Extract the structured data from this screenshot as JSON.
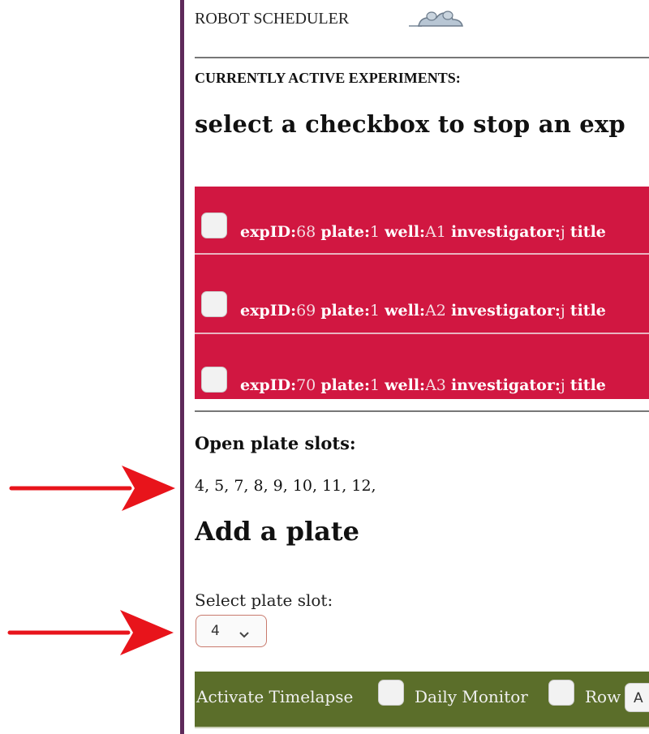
{
  "header": {
    "title": "ROBOT SCHEDULER",
    "logo_icon": "robot-icon"
  },
  "active": {
    "section_title": "CURRENTLY ACTIVE EXPERIMENTS:",
    "instruction": "select a checkbox to stop an exp",
    "field_labels": {
      "exp_id": "expID:",
      "plate": "plate:",
      "well": "well:",
      "investigator": "investigator:",
      "title_partial": "title"
    },
    "rows": [
      {
        "exp_id": "68",
        "plate": "1",
        "well": "A1",
        "investigator": "j",
        "checked": false
      },
      {
        "exp_id": "69",
        "plate": "1",
        "well": "A2",
        "investigator": "j",
        "checked": false
      },
      {
        "exp_id": "70",
        "plate": "1",
        "well": "A3",
        "investigator": "j",
        "checked": false
      }
    ]
  },
  "open_slots": {
    "label": "Open plate slots:",
    "list": "4, 5, 7, 8, 9, 10, 11, 12,"
  },
  "add_plate": {
    "heading": "Add a plate",
    "select_label": "Select plate slot:",
    "selected_slot": "4"
  },
  "options": {
    "activate_timelapse_label": "Activate Timelapse",
    "activate_timelapse_checked": false,
    "daily_monitor_label": "Daily Monitor",
    "daily_monitor_checked": false,
    "row_label": "Row",
    "row_value": "A"
  },
  "colors": {
    "active_table_bg": "#d11741",
    "options_bar_bg": "#5b6e2a",
    "page_border": "#5e2a5a",
    "arrow": "#e8141b"
  }
}
